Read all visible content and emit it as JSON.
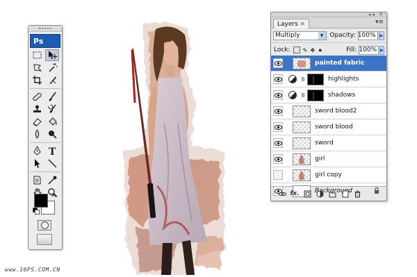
{
  "toolbox": {
    "logo": "Ps",
    "tools": [
      "marquee-tool-icon",
      "move-tool-icon",
      "lasso-tool-icon",
      "magic-wand-tool-icon",
      "crop-tool-icon",
      "slice-tool-icon",
      "healing-brush-tool-icon",
      "brush-tool-icon",
      "clone-stamp-tool-icon",
      "history-brush-tool-icon",
      "eraser-tool-icon",
      "paint-bucket-tool-icon",
      "blur-tool-icon",
      "dodge-tool-icon",
      "pen-tool-icon",
      "type-tool-icon",
      "path-selection-tool-icon",
      "line-tool-icon",
      "notes-tool-icon",
      "eyedropper-tool-icon",
      "hand-tool-icon",
      "zoom-tool-icon"
    ],
    "selected_tool": "move-tool-icon",
    "foreground_color": "#000000",
    "background_color": "#ffffff"
  },
  "layers_panel": {
    "tab_label": "Layers",
    "blend_mode": "Multiply",
    "opacity_label": "Opacity:",
    "opacity_value": "100%",
    "lock_label": "Lock:",
    "fill_label": "Fill:",
    "fill_value": "100%",
    "layers": [
      {
        "name": "painted fabric",
        "active": true,
        "visible": true,
        "type": "fabric"
      },
      {
        "name": "highlights",
        "active": false,
        "visible": true,
        "type": "adjustment"
      },
      {
        "name": "shadows",
        "active": false,
        "visible": true,
        "type": "adjustment"
      },
      {
        "name": "sword blood2",
        "active": false,
        "visible": true,
        "type": "transparent"
      },
      {
        "name": "sword blood",
        "active": false,
        "visible": true,
        "type": "transparent"
      },
      {
        "name": "sword",
        "active": false,
        "visible": true,
        "type": "transparent"
      },
      {
        "name": "girl",
        "active": false,
        "visible": true,
        "type": "girl"
      },
      {
        "name": "girl copy",
        "active": false,
        "visible": false,
        "type": "girl"
      },
      {
        "name": "Background",
        "active": false,
        "visible": true,
        "type": "background",
        "locked": true
      }
    ],
    "footer_icons": [
      "link-layers-icon",
      "fx-icon",
      "add-mask-icon",
      "adjustment-layer-icon",
      "new-group-icon",
      "new-layer-icon",
      "delete-layer-icon"
    ],
    "fx_label": "fx."
  },
  "colors": {
    "active_layer_bg": "#3c74c8",
    "ps_logo_bg": "#1e5cb3"
  },
  "watermark": "www.16PS.COM.CN"
}
